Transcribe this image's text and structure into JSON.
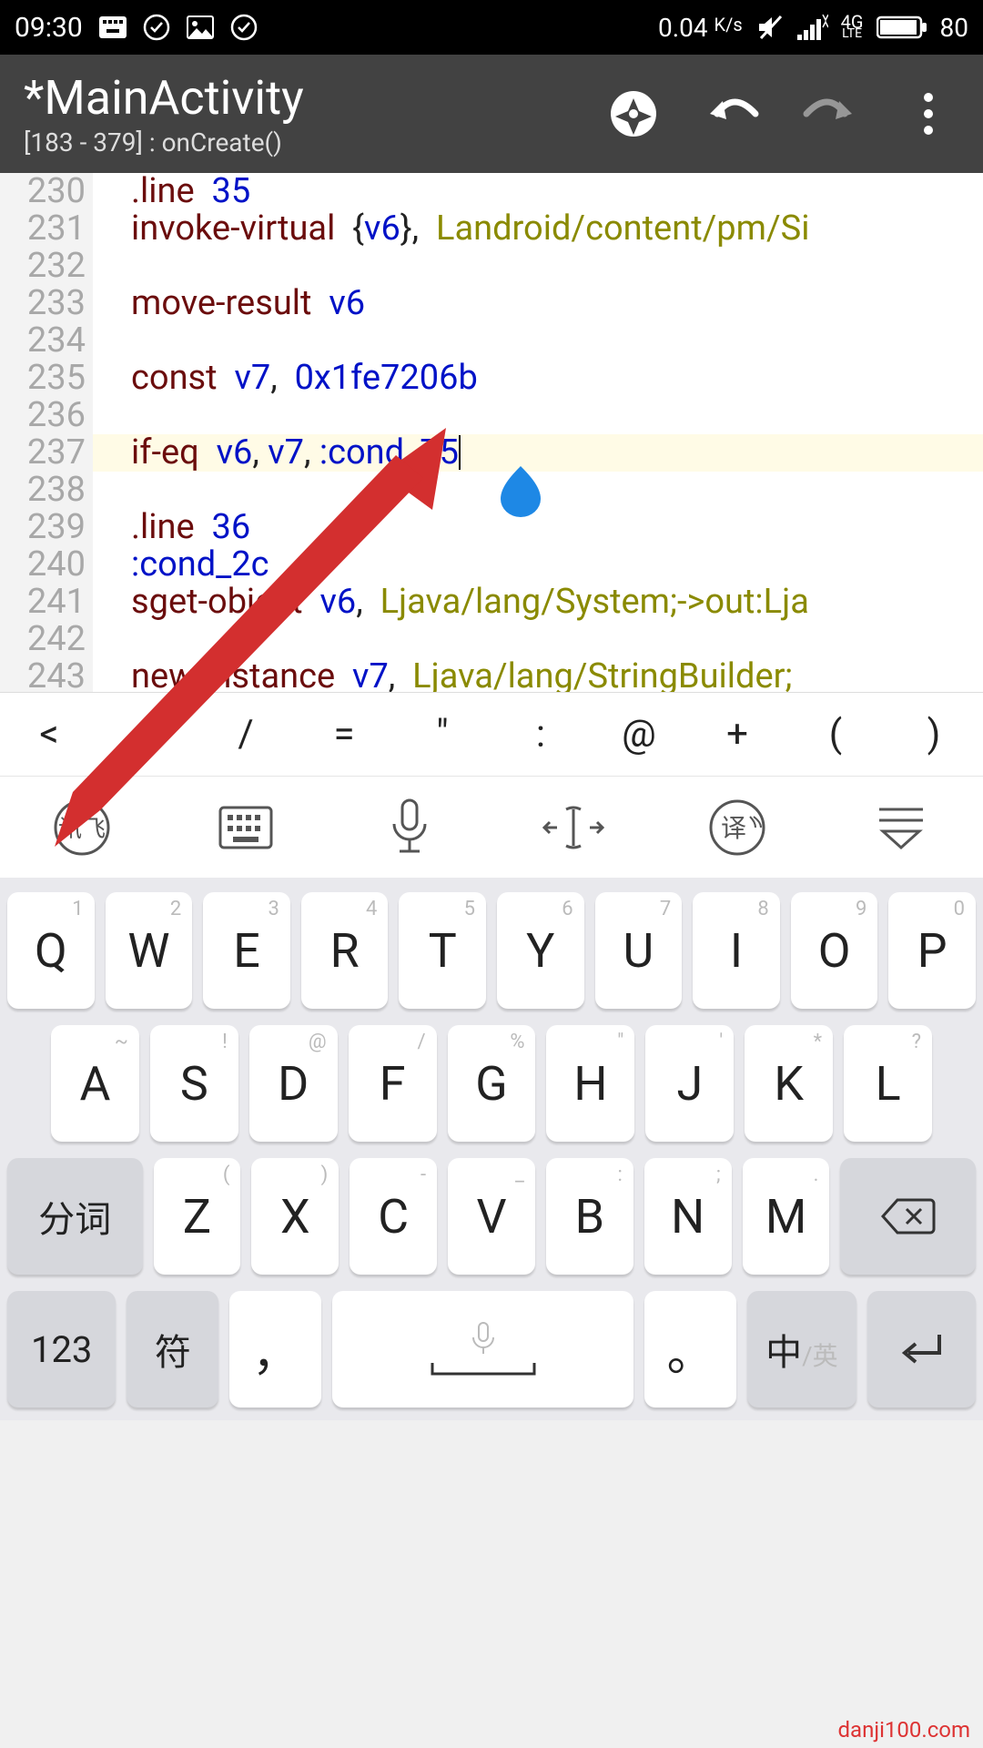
{
  "status": {
    "time": "09:30",
    "net_speed": "0.04",
    "net_unit": "K/s",
    "net_label": "4G",
    "net_sub": "LTE",
    "battery": "80"
  },
  "appbar": {
    "title": "*MainActivity",
    "subtitle": "[183 - 379] : onCreate()"
  },
  "gutter": [
    "230",
    "231",
    "232",
    "233",
    "234",
    "235",
    "236",
    "237",
    "238",
    "239",
    "240",
    "241",
    "242",
    "243"
  ],
  "code": {
    "l230": {
      "dir": ".line",
      "num": "35"
    },
    "l231": {
      "kw": "invoke-virtual",
      "args": "{",
      "v": "v6",
      "args2": "},",
      "type": "Landroid/content/pm/Si"
    },
    "l233": {
      "kw": "move-result",
      "v": "v6"
    },
    "l235": {
      "kw": "const",
      "v": "v7",
      "sep": ",",
      "num": "0x1fe7206b"
    },
    "l237": {
      "kw": "if-eq",
      "v1": "v6",
      "v2": "v7",
      "label": ":cond_75"
    },
    "l239": {
      "dir": ".line",
      "num": "36"
    },
    "l240": {
      "label": ":cond_2c"
    },
    "l241": {
      "kw": "sget-object",
      "v": "v6",
      "sep": ",",
      "type": "Ljava/lang/System;->out:Lja"
    },
    "l243": {
      "kw": "new-instance",
      "v": "v7",
      "sep": ",",
      "type": "Ljava/lang/StringBuilder;"
    }
  },
  "symbols": [
    "<",
    ">",
    "/",
    "=",
    "\"",
    ":",
    "@",
    "+",
    "(",
    ")"
  ],
  "ime": {
    "brand": "讯飞"
  },
  "keyboard": {
    "row1": [
      {
        "t": "1",
        "m": "Q"
      },
      {
        "t": "2",
        "m": "W"
      },
      {
        "t": "3",
        "m": "E"
      },
      {
        "t": "4",
        "m": "R"
      },
      {
        "t": "5",
        "m": "T"
      },
      {
        "t": "6",
        "m": "Y"
      },
      {
        "t": "7",
        "m": "U"
      },
      {
        "t": "8",
        "m": "I"
      },
      {
        "t": "9",
        "m": "O"
      },
      {
        "t": "0",
        "m": "P"
      }
    ],
    "row2": [
      {
        "t": "~",
        "m": "A"
      },
      {
        "t": "!",
        "m": "S"
      },
      {
        "t": "@",
        "m": "D"
      },
      {
        "t": "/",
        "m": "F"
      },
      {
        "t": "%",
        "m": "G"
      },
      {
        "t": "\"",
        "m": "H"
      },
      {
        "t": "'",
        "m": "J"
      },
      {
        "t": "*",
        "m": "K"
      },
      {
        "t": "?",
        "m": "L"
      }
    ],
    "row3_left": "分词",
    "row3": [
      {
        "t": "(",
        "m": "Z"
      },
      {
        "t": ")",
        "m": "X"
      },
      {
        "t": "-",
        "m": "C"
      },
      {
        "t": "_",
        "m": "V"
      },
      {
        "t": ":",
        "m": "B"
      },
      {
        "t": ";",
        "m": "N"
      },
      {
        "t": ".",
        "m": "M"
      }
    ],
    "row4": {
      "num": "123",
      "sym": "符",
      "comma": "，",
      "period": "。",
      "lang_main": "中",
      "lang_sub": "/英"
    }
  },
  "watermark": "danji100.com"
}
